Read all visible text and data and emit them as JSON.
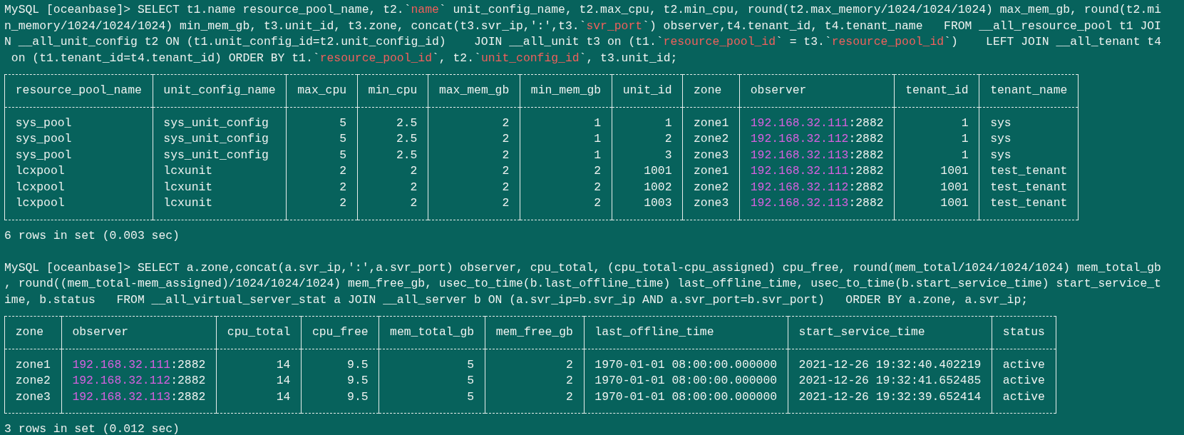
{
  "blocks": [
    {
      "kind": "query",
      "lines": [
        [
          {
            "text": "MySQL [oceanbase]> SELECT t1.name resource_pool_name, t2.`"
          },
          {
            "text": "name",
            "kind": "quoted"
          },
          {
            "text": "` unit_config_name, t2.max_cpu, t2.min_cpu, round(t2.max_memory/1024/1024/1024) max_mem_gb, round(t2.mi"
          }
        ],
        [
          {
            "text": "n_memory/1024/1024/1024) min_mem_gb, t3.unit_id, t3.zone, concat(t3.svr_ip,':',t3.`"
          },
          {
            "text": "svr_port",
            "kind": "quoted"
          },
          {
            "text": "`) observer,t4.tenant_id, t4.tenant_name   FROM __all_resource_pool t1 JOI"
          }
        ],
        [
          {
            "text": "N __all_unit_config t2 ON (t1.unit_config_id=t2.unit_config_id)    JOIN __all_unit t3 on (t1.`"
          },
          {
            "text": "resource_pool_id",
            "kind": "quoted"
          },
          {
            "text": "` = t3.`"
          },
          {
            "text": "resource_pool_id",
            "kind": "quoted"
          },
          {
            "text": "`)    LEFT JOIN __all_tenant t4"
          }
        ],
        [
          {
            "text": " on (t1.tenant_id=t4.tenant_id) ORDER BY t1.`"
          },
          {
            "text": "resource_pool_id",
            "kind": "quoted"
          },
          {
            "text": "`, t2.`"
          },
          {
            "text": "unit_config_id",
            "kind": "quoted"
          },
          {
            "text": "`, t3.unit_id;"
          }
        ]
      ]
    },
    {
      "kind": "table",
      "columns": [
        {
          "label": "resource_pool_name",
          "numeric": false
        },
        {
          "label": "unit_config_name",
          "numeric": false
        },
        {
          "label": "max_cpu",
          "numeric": true
        },
        {
          "label": "min_cpu",
          "numeric": true
        },
        {
          "label": "max_mem_gb",
          "numeric": true
        },
        {
          "label": "min_mem_gb",
          "numeric": true
        },
        {
          "label": "unit_id",
          "numeric": true
        },
        {
          "label": "zone"
        },
        {
          "label": "observer"
        },
        {
          "label": "tenant_id",
          "numeric": true
        },
        {
          "label": "tenant_name",
          "numeric": false
        }
      ],
      "rows": [
        [
          "sys_pool",
          "sys_unit_config",
          "5",
          "2.5",
          "2",
          "1",
          "1",
          "zone1",
          {
            "host": "192.168.32.111",
            "port": ":2882"
          },
          "1",
          "sys"
        ],
        [
          "sys_pool",
          "sys_unit_config",
          "5",
          "2.5",
          "2",
          "1",
          "2",
          "zone2",
          {
            "host": "192.168.32.112",
            "port": ":2882"
          },
          "1",
          "sys"
        ],
        [
          "sys_pool",
          "sys_unit_config",
          "5",
          "2.5",
          "2",
          "1",
          "3",
          "zone3",
          {
            "host": "192.168.32.113",
            "port": ":2882"
          },
          "1",
          "sys"
        ],
        [
          "lcxpool",
          "lcxunit",
          "2",
          "2",
          "2",
          "2",
          "1001",
          "zone1",
          {
            "host": "192.168.32.111",
            "port": ":2882"
          },
          "1001",
          "test_tenant"
        ],
        [
          "lcxpool",
          "lcxunit",
          "2",
          "2",
          "2",
          "2",
          "1002",
          "zone2",
          {
            "host": "192.168.32.112",
            "port": ":2882"
          },
          "1001",
          "test_tenant"
        ],
        [
          "lcxpool",
          "lcxunit",
          "2",
          "2",
          "2",
          "2",
          "1003",
          "zone3",
          {
            "host": "192.168.32.113",
            "port": ":2882"
          },
          "1001",
          "test_tenant"
        ]
      ]
    },
    {
      "kind": "summary",
      "text": "6 rows in set (0.003 sec)"
    },
    {
      "kind": "blank"
    },
    {
      "kind": "query",
      "lines": [
        [
          {
            "text": "MySQL [oceanbase]> SELECT a.zone,concat(a.svr_ip,':',a.svr_port) observer, cpu_total, (cpu_total-cpu_assigned) cpu_free, round(mem_total/1024/1024/1024) mem_total_gb"
          }
        ],
        [
          {
            "text": ", round((mem_total-mem_assigned)/1024/1024/1024) mem_free_gb, usec_to_time(b.last_offline_time) last_offline_time, usec_to_time(b.start_service_time) start_service_t"
          }
        ],
        [
          {
            "text": "ime, b.status   FROM __all_virtual_server_stat a JOIN __all_server b ON (a.svr_ip=b.svr_ip AND a.svr_port=b.svr_port)   ORDER BY a.zone, a.svr_ip;"
          }
        ]
      ]
    },
    {
      "kind": "table",
      "columns": [
        {
          "label": "zone"
        },
        {
          "label": "observer"
        },
        {
          "label": "cpu_total",
          "numeric": true
        },
        {
          "label": "cpu_free",
          "numeric": true
        },
        {
          "label": "mem_total_gb",
          "numeric": true
        },
        {
          "label": "mem_free_gb",
          "numeric": true
        },
        {
          "label": "last_offline_time"
        },
        {
          "label": "start_service_time"
        },
        {
          "label": "status"
        }
      ],
      "rows": [
        [
          "zone1",
          {
            "host": "192.168.32.111",
            "port": ":2882"
          },
          "14",
          "9.5",
          "5",
          "2",
          "1970-01-01 08:00:00.000000",
          "2021-12-26 19:32:40.402219",
          "active"
        ],
        [
          "zone2",
          {
            "host": "192.168.32.112",
            "port": ":2882"
          },
          "14",
          "9.5",
          "5",
          "2",
          "1970-01-01 08:00:00.000000",
          "2021-12-26 19:32:41.652485",
          "active"
        ],
        [
          "zone3",
          {
            "host": "192.168.32.113",
            "port": ":2882"
          },
          "14",
          "9.5",
          "5",
          "2",
          "1970-01-01 08:00:00.000000",
          "2021-12-26 19:32:39.652414",
          "active"
        ]
      ]
    },
    {
      "kind": "summary",
      "text": "3 rows in set (0.012 sec)"
    }
  ]
}
